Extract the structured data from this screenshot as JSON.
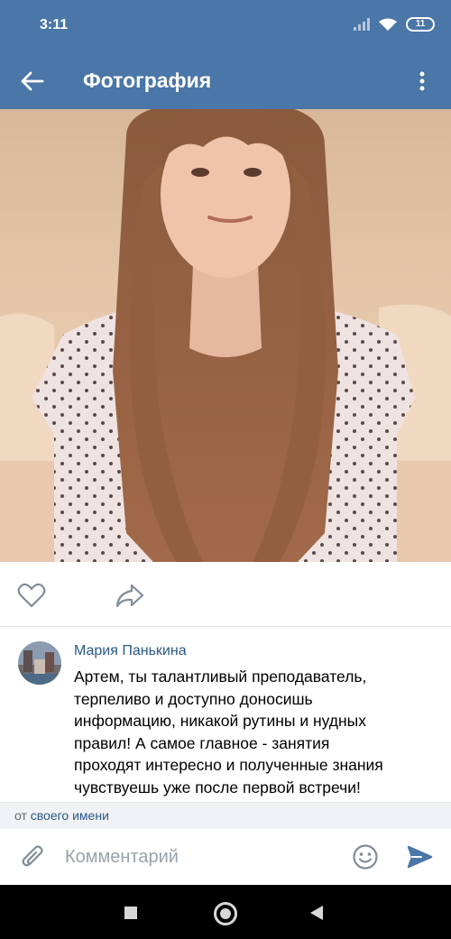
{
  "status_bar": {
    "time": "3:11",
    "battery": "11",
    "icons": [
      "signal-icon",
      "wifi-icon",
      "battery-icon"
    ]
  },
  "app_bar": {
    "title": "Фотография",
    "back_icon": "arrow-left-icon",
    "menu_icon": "more-vertical-icon",
    "color": "#4a76a8"
  },
  "photo": {
    "icon": "portrait-photo"
  },
  "actions": {
    "like_icon": "heart-outline-icon",
    "share_icon": "share-arrow-icon"
  },
  "comment": {
    "author": "Мария Панькина",
    "lines": [
      "Артем, ты талантливый преподаватель,",
      "терпеливо и доступно доносишь",
      "информацию, никакой рутины и нудных",
      "правил! А самое главное - занятия",
      "проходят интересно и полученные знания",
      "чувствуешь уже после первой встречи!"
    ],
    "author_color": "#2a5885"
  },
  "from_bar": {
    "prefix": "от",
    "name": "своего имени"
  },
  "input_bar": {
    "placeholder": "Комментарий",
    "attach_icon": "paperclip-icon",
    "emoji_icon": "smiley-icon",
    "send_icon": "send-icon",
    "accent": "#4a76a8"
  },
  "nav_bar": {
    "icons": [
      "square-recents-icon",
      "circle-home-icon",
      "triangle-back-icon"
    ]
  }
}
